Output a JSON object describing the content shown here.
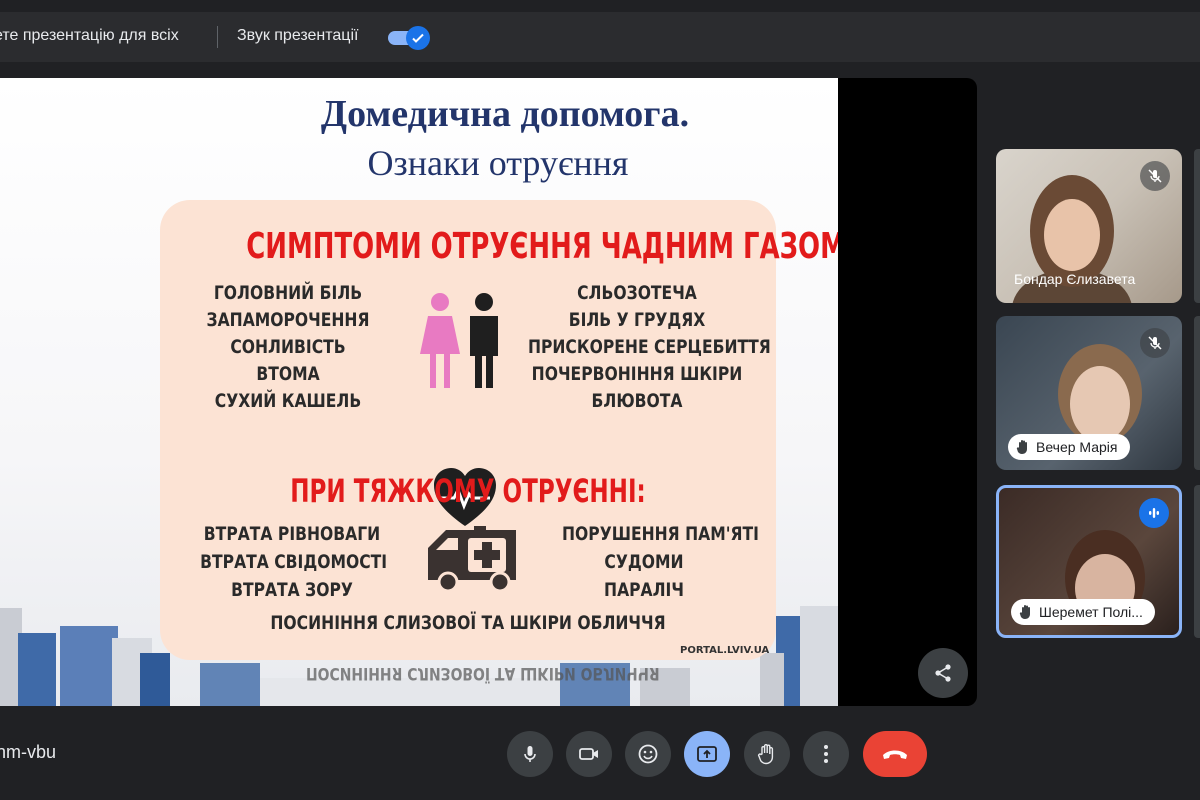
{
  "topbar": {
    "present_label": "ете презентацію для всіх",
    "audio_label": "Звук презентації",
    "audio_on": true
  },
  "slide": {
    "title": "Домедична допомога.",
    "subtitle": "Ознаки отруєння",
    "heading1": "СИМПТОМИ ОТРУЄННЯ ЧАДНИМ ГАЗОМ:",
    "symptoms_left": [
      "ГОЛОВНИЙ БІЛЬ",
      "ЗАПАМОРОЧЕННЯ",
      "СОНЛИВІСТЬ",
      "ВТОМА",
      "СУХИЙ КАШЕЛЬ"
    ],
    "symptoms_right": [
      "СЛЬОЗОТЕЧА",
      "БІЛЬ У ГРУДЯХ",
      "ПРИСКОРЕНЕ СЕРЦЕБИТТЯ",
      "ПОЧЕРВОНІННЯ ШКІРИ",
      "БЛЮВОТА"
    ],
    "heading2": "ПРИ ТЯЖКОМУ ОТРУЄННІ:",
    "severe_left": [
      "ВТРАТА РІВНОВАГИ",
      "ВТРАТА СВІДОМОСТІ",
      "ВТРАТА ЗОРУ"
    ],
    "severe_right": [
      "ПОРУШЕННЯ ПАМ'ЯТІ",
      "СУДОМИ",
      "ПАРАЛІЧ"
    ],
    "severe_bottom": "ПОСИНІННЯ СЛИЗОВОЇ ТА ШКІРИ ОБЛИЧЧЯ",
    "source": "PORTAL.LVIV.UA"
  },
  "participants": [
    {
      "name": "Бондар Єлизавета",
      "muted": true
    },
    {
      "name": "Вечер Марія",
      "muted": true
    },
    {
      "name": "Шеремет Полі...",
      "speaking": true
    }
  ],
  "meeting_code": "nm-vbu",
  "colors": {
    "accent": "#8ab4f8",
    "leave": "#ea4335",
    "title": "#23356b",
    "heading_red": "#e21b1b",
    "card_bg": "#fce3d4"
  },
  "icons": {
    "share": "share-icon",
    "mic": "mic-icon",
    "camera": "camera-icon",
    "emoji": "emoji-icon",
    "present": "present-screen-icon",
    "hand": "raise-hand-icon",
    "more": "more-vert-icon",
    "leave": "phone-hangup-icon"
  }
}
